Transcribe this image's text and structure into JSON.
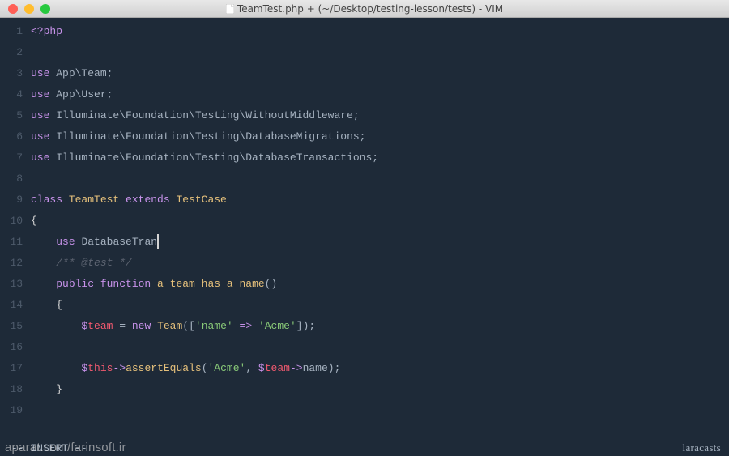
{
  "titlebar": {
    "title": "TeamTest.php + (~/Desktop/testing-lesson/tests) - VIM"
  },
  "lines": [
    {
      "n": "1",
      "tokens": [
        {
          "t": "tag",
          "v": "<?php"
        }
      ]
    },
    {
      "n": "2",
      "tokens": []
    },
    {
      "n": "3",
      "tokens": [
        {
          "t": "keyword",
          "v": "use "
        },
        {
          "t": "punct",
          "v": "App\\Team;"
        }
      ]
    },
    {
      "n": "4",
      "tokens": [
        {
          "t": "keyword",
          "v": "use "
        },
        {
          "t": "punct",
          "v": "App\\User;"
        }
      ]
    },
    {
      "n": "5",
      "tokens": [
        {
          "t": "keyword",
          "v": "use "
        },
        {
          "t": "punct",
          "v": "Illuminate\\Foundation\\Testing\\WithoutMiddleware;"
        }
      ]
    },
    {
      "n": "6",
      "tokens": [
        {
          "t": "keyword",
          "v": "use "
        },
        {
          "t": "punct",
          "v": "Illuminate\\Foundation\\Testing\\DatabaseMigrations;"
        }
      ]
    },
    {
      "n": "7",
      "tokens": [
        {
          "t": "keyword",
          "v": "use "
        },
        {
          "t": "punct",
          "v": "Illuminate\\Foundation\\Testing\\DatabaseTransactions;"
        }
      ]
    },
    {
      "n": "8",
      "tokens": []
    },
    {
      "n": "9",
      "tokens": [
        {
          "t": "keyword",
          "v": "class "
        },
        {
          "t": "classname",
          "v": "TeamTest"
        },
        {
          "t": "keyword",
          "v": " extends "
        },
        {
          "t": "classname",
          "v": "TestCase"
        }
      ]
    },
    {
      "n": "10",
      "tokens": [
        {
          "t": "brace",
          "v": "{"
        }
      ]
    },
    {
      "n": "11",
      "tokens": [
        {
          "t": "punct",
          "v": "    "
        },
        {
          "t": "keyword",
          "v": "use "
        },
        {
          "t": "punct",
          "v": "DatabaseTran"
        },
        {
          "t": "cursor",
          "v": ""
        }
      ]
    },
    {
      "n": "12",
      "tokens": [
        {
          "t": "punct",
          "v": "    "
        },
        {
          "t": "comment",
          "v": "/** @test */"
        }
      ]
    },
    {
      "n": "13",
      "tokens": [
        {
          "t": "punct",
          "v": "    "
        },
        {
          "t": "keyword",
          "v": "public "
        },
        {
          "t": "keyword",
          "v": "function "
        },
        {
          "t": "func",
          "v": "a_team_has_a_name"
        },
        {
          "t": "punct",
          "v": "()"
        }
      ]
    },
    {
      "n": "14",
      "tokens": [
        {
          "t": "punct",
          "v": "    "
        },
        {
          "t": "brace",
          "v": "{"
        }
      ]
    },
    {
      "n": "15",
      "tokens": [
        {
          "t": "punct",
          "v": "        "
        },
        {
          "t": "var-dollar",
          "v": "$"
        },
        {
          "t": "var",
          "v": "team"
        },
        {
          "t": "punct",
          "v": " = "
        },
        {
          "t": "keyword",
          "v": "new "
        },
        {
          "t": "classname",
          "v": "Team"
        },
        {
          "t": "punct",
          "v": "(["
        },
        {
          "t": "string",
          "v": "'name'"
        },
        {
          "t": "punct",
          "v": " "
        },
        {
          "t": "arrow",
          "v": "=>"
        },
        {
          "t": "punct",
          "v": " "
        },
        {
          "t": "string",
          "v": "'Acme'"
        },
        {
          "t": "punct",
          "v": "]);"
        }
      ]
    },
    {
      "n": "16",
      "tokens": []
    },
    {
      "n": "17",
      "tokens": [
        {
          "t": "punct",
          "v": "        "
        },
        {
          "t": "var-dollar",
          "v": "$"
        },
        {
          "t": "var",
          "v": "this"
        },
        {
          "t": "arrow",
          "v": "->"
        },
        {
          "t": "func",
          "v": "assertEquals"
        },
        {
          "t": "punct",
          "v": "("
        },
        {
          "t": "string",
          "v": "'Acme'"
        },
        {
          "t": "punct",
          "v": ", "
        },
        {
          "t": "var-dollar",
          "v": "$"
        },
        {
          "t": "var",
          "v": "team"
        },
        {
          "t": "arrow",
          "v": "->"
        },
        {
          "t": "punct",
          "v": "name);"
        }
      ]
    },
    {
      "n": "18",
      "tokens": [
        {
          "t": "punct",
          "v": "    "
        },
        {
          "t": "brace",
          "v": "}"
        }
      ]
    },
    {
      "n": "19",
      "tokens": []
    }
  ],
  "status": {
    "mode": "-- INSERT --",
    "brand": "laracasts"
  },
  "watermark": "aparat.com/farinsoft.ir"
}
